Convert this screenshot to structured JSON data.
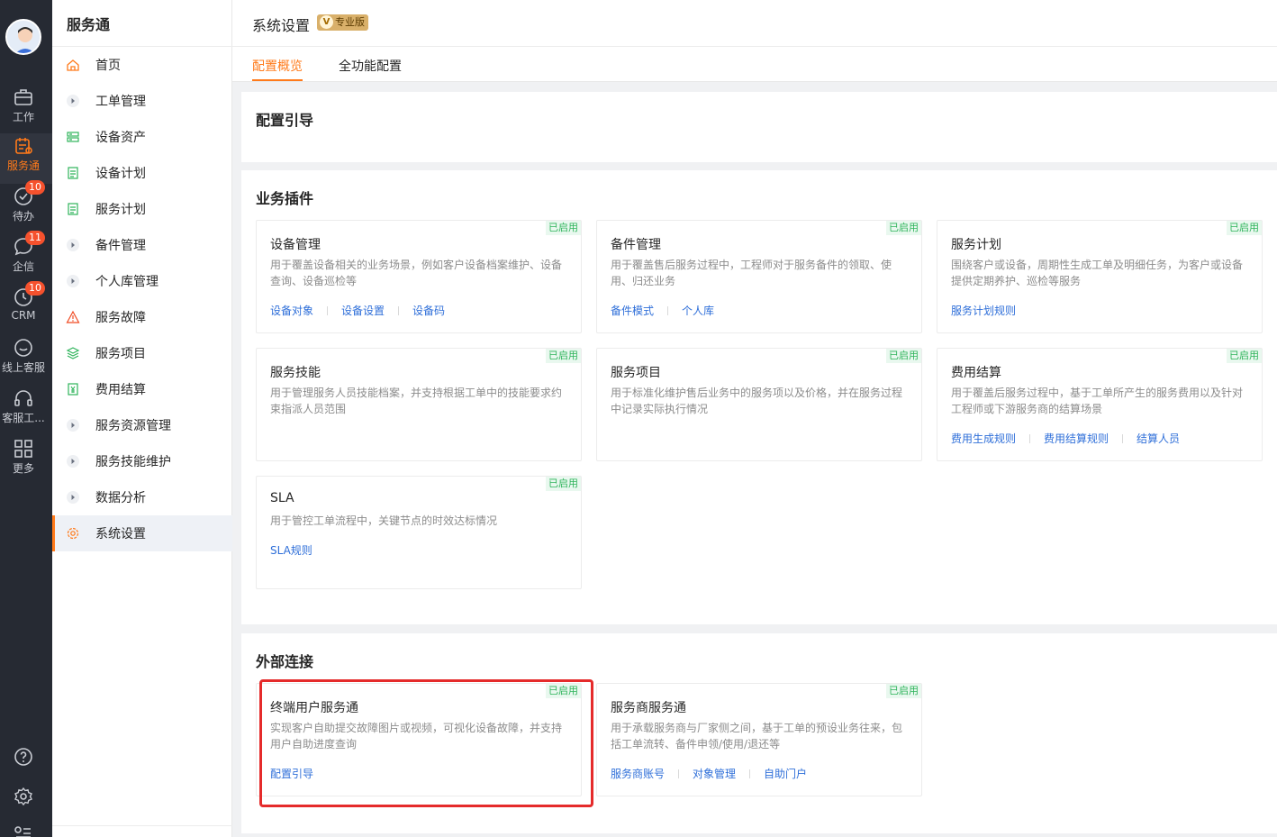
{
  "rail": {
    "items": [
      {
        "label": "工作",
        "icon": "briefcase-icon",
        "badge": ""
      },
      {
        "label": "服务通",
        "icon": "service-icon",
        "badge": ""
      },
      {
        "label": "待办",
        "icon": "check-circle-icon",
        "badge": "10"
      },
      {
        "label": "企信",
        "icon": "chat-icon",
        "badge": "11"
      },
      {
        "label": "CRM",
        "icon": "clock-icon",
        "badge": "10"
      },
      {
        "label": "线上客服",
        "icon": "smile-chat-icon",
        "badge": ""
      },
      {
        "label": "客服工...",
        "icon": "headset-icon",
        "badge": ""
      },
      {
        "label": "更多",
        "icon": "grid-icon",
        "badge": ""
      }
    ],
    "bottom_icons": [
      "help-icon",
      "settings-icon",
      "list-icon"
    ]
  },
  "side": {
    "title": "服务通",
    "items": [
      {
        "label": "首页",
        "icon": "home-icon",
        "color": "#ff7a1a"
      },
      {
        "label": "工单管理",
        "icon": "caret-right-icon",
        "color": "#6b7280"
      },
      {
        "label": "设备资产",
        "icon": "device-icon",
        "color": "#2fb45b"
      },
      {
        "label": "设备计划",
        "icon": "plan-icon",
        "color": "#2fb45b"
      },
      {
        "label": "服务计划",
        "icon": "plan-icon",
        "color": "#2fb45b"
      },
      {
        "label": "备件管理",
        "icon": "caret-right-icon",
        "color": "#6b7280"
      },
      {
        "label": "个人库管理",
        "icon": "caret-right-icon",
        "color": "#6b7280"
      },
      {
        "label": "服务故障",
        "icon": "warning-icon",
        "color": "#f04b23"
      },
      {
        "label": "服务项目",
        "icon": "layers-icon",
        "color": "#2fb45b"
      },
      {
        "label": "费用结算",
        "icon": "yen-icon",
        "color": "#2fb45b"
      },
      {
        "label": "服务资源管理",
        "icon": "caret-right-icon",
        "color": "#6b7280"
      },
      {
        "label": "服务技能维护",
        "icon": "caret-right-icon",
        "color": "#6b7280"
      },
      {
        "label": "数据分析",
        "icon": "caret-right-icon",
        "color": "#6b7280"
      },
      {
        "label": "系统设置",
        "icon": "gear-icon",
        "color": "#ff7a1a"
      }
    ],
    "active_index": 13
  },
  "header": {
    "title": "系统设置",
    "badge": "专业版",
    "badge_icon_letter": "V"
  },
  "tabs": [
    {
      "label": "配置概览",
      "active": true
    },
    {
      "label": "全功能配置",
      "active": false
    }
  ],
  "sections": {
    "guide": {
      "title": "配置引导"
    },
    "plugins": {
      "title": "业务插件",
      "cards": [
        {
          "title": "设备管理",
          "status": "已启用",
          "desc": "用于覆盖设备相关的业务场景，例如客户设备档案维护、设备查询、设备巡检等",
          "links": [
            "设备对象",
            "设备设置",
            "设备码"
          ]
        },
        {
          "title": "备件管理",
          "status": "已启用",
          "desc": "用于覆盖售后服务过程中，工程师对于服务备件的领取、使用、归还业务",
          "links": [
            "备件模式",
            "个人库"
          ]
        },
        {
          "title": "服务计划",
          "status": "已启用",
          "desc": "围绕客户或设备，周期性生成工单及明细任务，为客户或设备提供定期养护、巡检等服务",
          "links": [
            "服务计划规则"
          ]
        },
        {
          "title": "服务技能",
          "status": "已启用",
          "desc": "用于管理服务人员技能档案，并支持根据工单中的技能要求约束指派人员范围",
          "links": []
        },
        {
          "title": "服务项目",
          "status": "已启用",
          "desc": "用于标准化维护售后业务中的服务项以及价格，并在服务过程中记录实际执行情况",
          "links": []
        },
        {
          "title": "费用结算",
          "status": "已启用",
          "desc": "用于覆盖后服务过程中，基于工单所产生的服务费用以及针对工程师或下游服务商的结算场景",
          "links": [
            "费用生成规则",
            "费用结算规则",
            "结算人员"
          ]
        },
        {
          "title": "SLA",
          "status": "已启用",
          "desc": "用于管控工单流程中，关键节点的时效达标情况",
          "links": [
            "SLA规则"
          ]
        }
      ]
    },
    "external": {
      "title": "外部连接",
      "cards": [
        {
          "title": "终端用户服务通",
          "status": "已启用",
          "desc": "实现客户自助提交故障图片或视频，可视化设备故障，并支持用户自助进度查询",
          "links": [
            "配置引导"
          ]
        },
        {
          "title": "服务商服务通",
          "status": "已启用",
          "desc": "用于承载服务商与厂家侧之间，基于工单的预设业务往来，包括工单流转、备件申领/使用/退还等",
          "links": [
            "服务商账号",
            "对象管理",
            "自助门户"
          ]
        }
      ]
    }
  },
  "colors": {
    "accent": "#ff7a1a",
    "link": "#2f6fd9",
    "status": "#2fb45b",
    "highlight": "#e52b2b"
  }
}
